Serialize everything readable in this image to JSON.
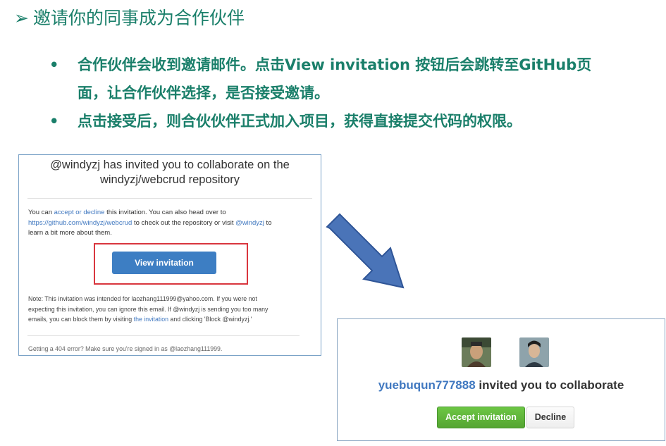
{
  "slide": {
    "title_marker": "➢",
    "title": "邀请你的同事成为合作伙伴",
    "bullets": [
      {
        "line1": "合作伙伴会收到邀请邮件。点击View invitation 按钮后会跳转至GitHub页",
        "line2": "面，让合作伙伴选择，是否接受邀请。"
      },
      {
        "line1": "点击接受后，则合伙伙伴正式加入项目，获得直接提交代码的权限。"
      }
    ]
  },
  "email": {
    "heading_line1": "@windyzj has invited you to collaborate on the",
    "heading_line2": "windyzj/webcrud repository",
    "body_p1_a": "You can ",
    "body_p1_link1": "accept or decline",
    "body_p1_b": " this invitation. You can also head over to",
    "body_p1_link2": "https://github.com/windyzj/webcrud",
    "body_p1_c": " to check out the repository or visit ",
    "body_p1_link3": "@windyzj",
    "body_p1_d": " to",
    "body_p1_e": "learn a bit more about them.",
    "view_button": "View invitation",
    "note_a": "Note: This invitation was intended for laozhang111999@yahoo.com. If you were not",
    "note_b": "expecting this invitation, you can ignore this email. If @windyzj is sending you too many",
    "note_c": "emails, you can block them by visiting ",
    "note_link": "the invitation",
    "note_d": " and clicking 'Block @windyzj.'",
    "footer": "Getting a 404 error? Make sure you're signed in as @laozhang111999."
  },
  "invite_card": {
    "username": "yuebuqun777888",
    "message": " invited you to collaborate",
    "accept_button": "Accept invitation",
    "decline_button": "Decline"
  },
  "colors": {
    "heading_green": "#1a7f6a",
    "link_blue": "#4078c0",
    "button_blue": "#3d7ec3",
    "accept_green": "#5cb85c",
    "highlight_red": "#d9363e",
    "arrow_blue": "#4a74b8"
  }
}
